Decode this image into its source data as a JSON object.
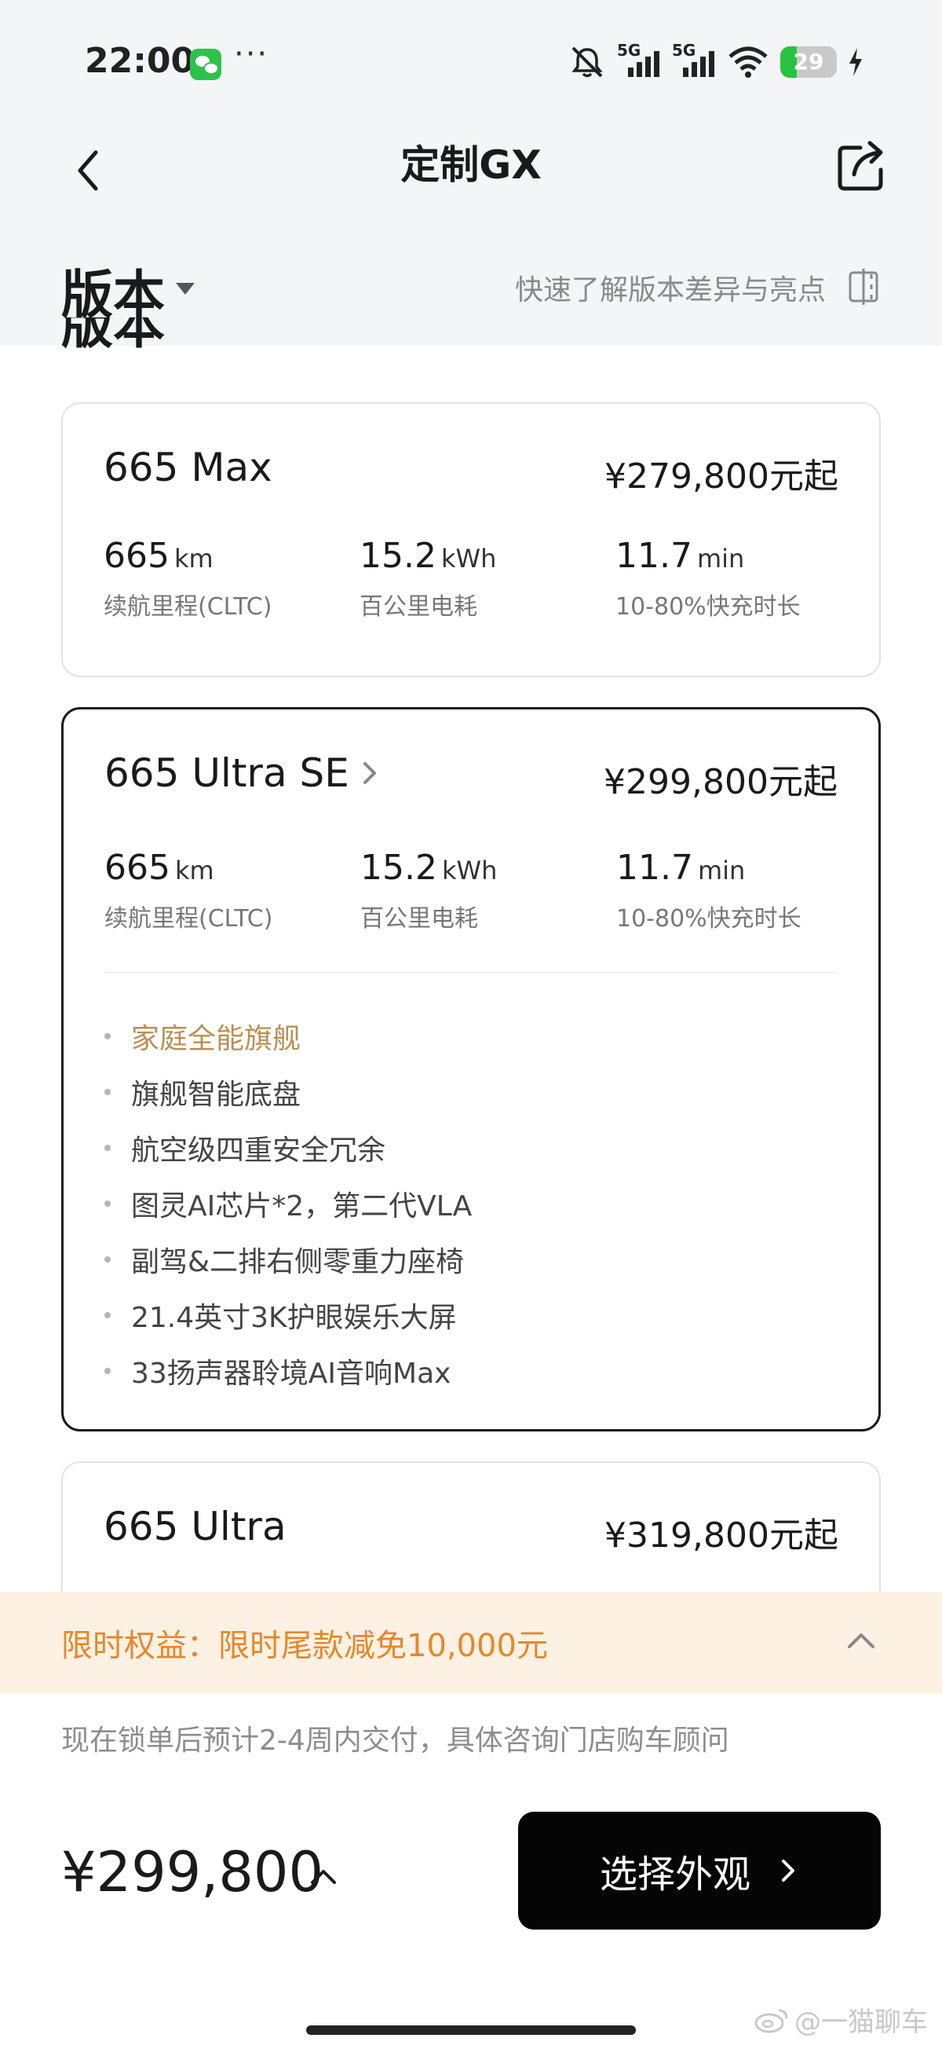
{
  "status_bar": {
    "time": "22:00",
    "more": "···",
    "signal_1_label": "5G",
    "signal_2_label": "5G",
    "battery_level": "29",
    "battery_fraction": 0.29
  },
  "nav": {
    "title": "定制GX"
  },
  "section": {
    "title": "版本",
    "compare_link": "快速了解版本差异与亮点",
    "scroll_ghost_title": "版本"
  },
  "versions": [
    {
      "name": "665 Max",
      "price": "¥279,800元起",
      "has_arrow": false,
      "selected": false,
      "specs": [
        {
          "value": "665",
          "unit": "km",
          "label": "续航里程(CLTC)"
        },
        {
          "value": "15.2",
          "unit": "kWh",
          "label": "百公里电耗"
        },
        {
          "value": "11.7",
          "unit": "min",
          "label": "10-80%快充时长"
        }
      ]
    },
    {
      "name": "665 Ultra SE",
      "price": "¥299,800元起",
      "has_arrow": true,
      "selected": true,
      "specs": [
        {
          "value": "665",
          "unit": "km",
          "label": "续航里程(CLTC)"
        },
        {
          "value": "15.2",
          "unit": "kWh",
          "label": "百公里电耗"
        },
        {
          "value": "11.7",
          "unit": "min",
          "label": "10-80%快充时长"
        }
      ],
      "features": [
        {
          "text": "家庭全能旗舰",
          "highlight": true
        },
        {
          "text": "旗舰智能底盘",
          "highlight": false
        },
        {
          "text": "航空级四重安全冗余",
          "highlight": false
        },
        {
          "text": "图灵AI芯片*2，第二代VLA",
          "highlight": false
        },
        {
          "text": "副驾&二排右侧零重力座椅",
          "highlight": false
        },
        {
          "text": "21.4英寸3K护眼娱乐大屏",
          "highlight": false
        },
        {
          "text": "33扬声器聆境AI音响Max",
          "highlight": false
        }
      ]
    },
    {
      "name": "665 Ultra",
      "price": "¥319,800元起",
      "has_arrow": false,
      "selected": false
    }
  ],
  "promo": {
    "text": "限时权益：限时尾款减免10,000元"
  },
  "footer": {
    "delivery_note": "现在锁单后预计2-4周内交付，具体咨询门店购车顾问",
    "total_price": "¥299,800",
    "cta_label": "选择外观"
  },
  "watermark": {
    "text": "@一猫聊车"
  },
  "colors": {
    "accent_gold": "#b89055",
    "promo_orange": "#e4882c",
    "promo_bg": "#fdf1e3",
    "cta_bg": "#050505",
    "battery_green": "#28c341"
  },
  "icons": {
    "back": "chevron-left-icon",
    "share": "share-icon",
    "compare": "compare-icon",
    "card_arrow": "chevron-right-icon",
    "promo_toggle": "chevron-up-icon",
    "price_detail": "chevron-up-icon",
    "cta_arrow": "chevron-right-icon"
  }
}
